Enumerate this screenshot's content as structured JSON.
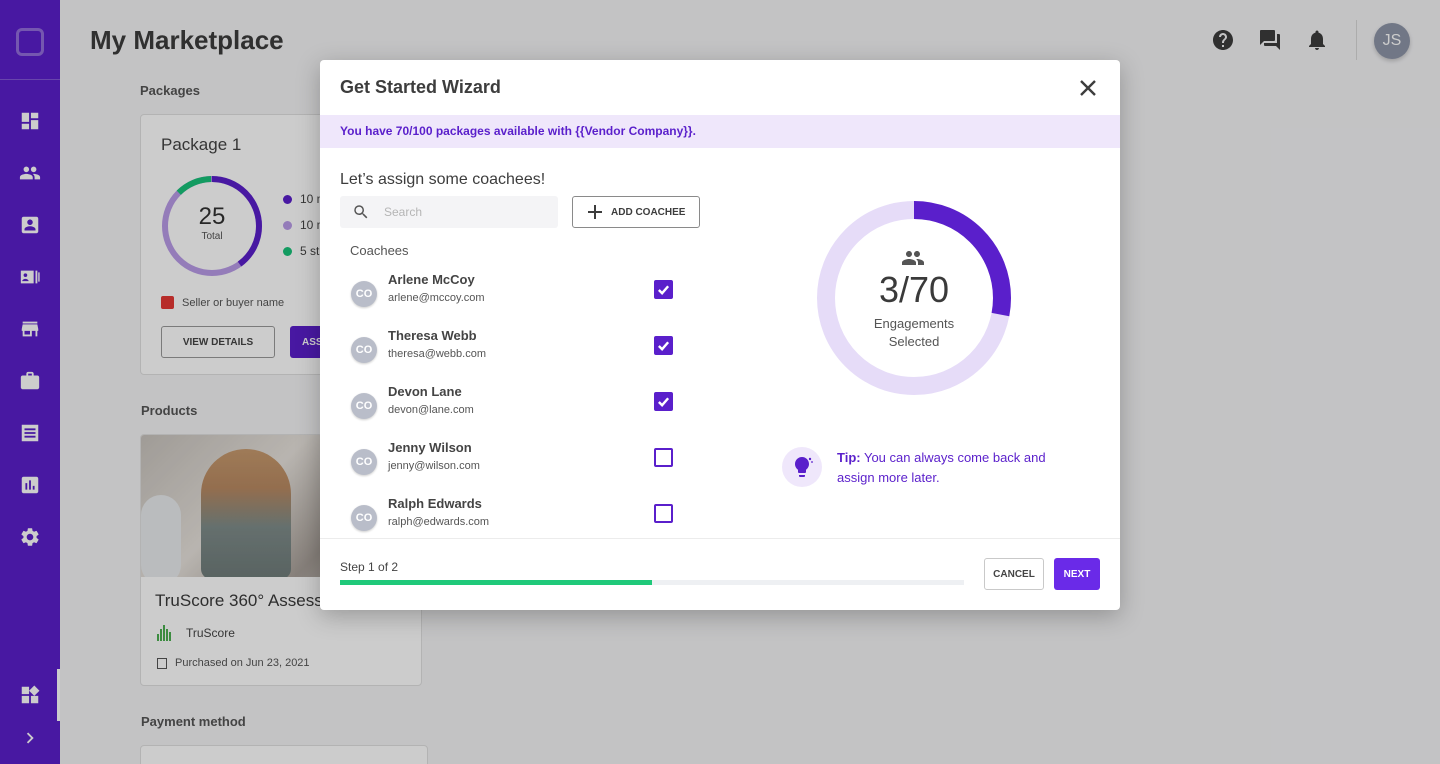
{
  "app": {
    "title": "My Marketplace",
    "user_initials": "JS"
  },
  "sidebar": {
    "items": [
      {
        "icon": "dashboard-icon"
      },
      {
        "icon": "people-icon"
      },
      {
        "icon": "portrait-icon"
      },
      {
        "icon": "contact-list-icon"
      },
      {
        "icon": "store-icon"
      },
      {
        "icon": "briefcase-icon"
      },
      {
        "icon": "document-list-icon"
      },
      {
        "icon": "bar-chart-icon"
      },
      {
        "icon": "gear-icon"
      },
      {
        "icon": "widgets-icon"
      },
      {
        "icon": "chevron-right-icon"
      }
    ]
  },
  "header": {
    "icons": [
      "help-icon",
      "chat-icon",
      "bell-icon"
    ]
  },
  "packages": {
    "section_label": "Packages",
    "card": {
      "title": "Package 1",
      "total_value": "25",
      "total_label": "Total",
      "legend": [
        "10 m",
        "10 m",
        "5 st"
      ],
      "seller": "Seller or buyer name",
      "view_details_label": "VIEW DETAILS",
      "assign_label": "ASS"
    }
  },
  "products": {
    "section_label": "Products",
    "card": {
      "name": "TruScore 360° Assess",
      "brand": "TruScore",
      "purchased": "Purchased on Jun 23, 2021"
    }
  },
  "payment": {
    "section_label": "Payment method"
  },
  "modal": {
    "title": "Get Started Wizard",
    "banner": "You have 70/100 packages available with {{Vendor Company}}.",
    "heading": "Let’s assign some coachees!",
    "search_placeholder": "Search",
    "add_coachee_label": "ADD COACHEE",
    "coachees_label": "Coachees",
    "coachees": [
      {
        "initials": "CO",
        "name": "Arlene McCoy",
        "email": "arlene@mccoy.com",
        "checked": true
      },
      {
        "initials": "CO",
        "name": "Theresa Webb",
        "email": "theresa@webb.com",
        "checked": true
      },
      {
        "initials": "CO",
        "name": "Devon Lane",
        "email": "devon@lane.com",
        "checked": true
      },
      {
        "initials": "CO",
        "name": "Jenny Wilson",
        "email": "jenny@wilson.com",
        "checked": false
      },
      {
        "initials": "CO",
        "name": "Ralph Edwards",
        "email": "ralph@edwards.com",
        "checked": false
      }
    ],
    "donut": {
      "count_text": "3/70",
      "label_line1": "Engagements",
      "label_line2": "Selected",
      "selected": 3,
      "total": 70,
      "accent_color": "#5a1fcb",
      "track_color": "#e6dcf8"
    },
    "tip": {
      "prefix": "Tip:",
      "text": " You can always come back and assign more later."
    },
    "footer": {
      "step_label": "Step 1 of 2",
      "progress": 0.5,
      "cancel_label": "CANCEL",
      "next_label": "NEXT"
    }
  }
}
